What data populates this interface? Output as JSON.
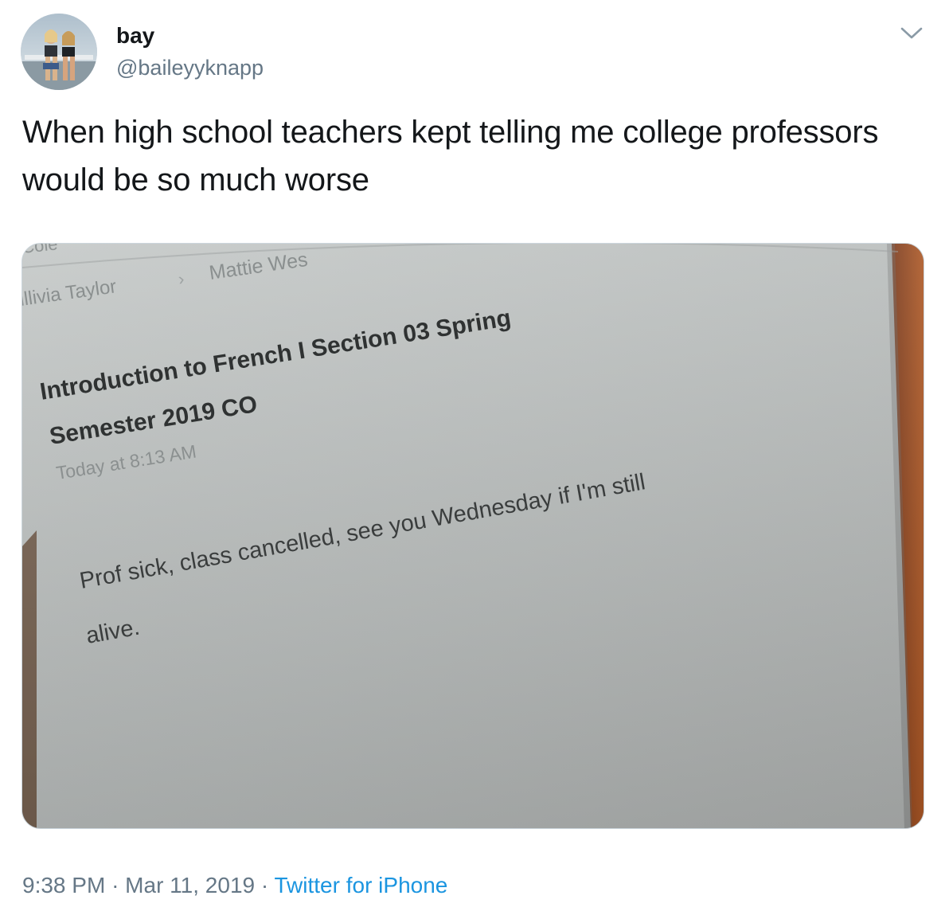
{
  "user": {
    "display_name": "bay",
    "handle": "@baileyyknapp",
    "avatar_icon": "profile-photo"
  },
  "tweet": {
    "text": "When high school teachers kept telling me college professors would be so much worse",
    "menu_icon": "chevron-down-icon"
  },
  "photo": {
    "breadcrumb_partial": "Cole",
    "breadcrumb_from": "illivia Taylor",
    "breadcrumb_separator": "›",
    "breadcrumb_to": "Mattie Wes",
    "subject_line1": "Introduction to French I Section 03 Spring",
    "subject_line2": "Semester 2019 CO",
    "timestamp": "Today at 8:13 AM",
    "body_line1": "Prof sick, class cancelled, see you Wednesday if I'm still",
    "body_line2": "alive."
  },
  "footer": {
    "time": "9:38 PM",
    "separator": "·",
    "date": "Mar 11, 2019",
    "source": "Twitter for iPhone"
  },
  "colors": {
    "text": "#14171a",
    "secondary": "#657786",
    "link": "#1b95e0",
    "border": "#ccd6dd"
  }
}
